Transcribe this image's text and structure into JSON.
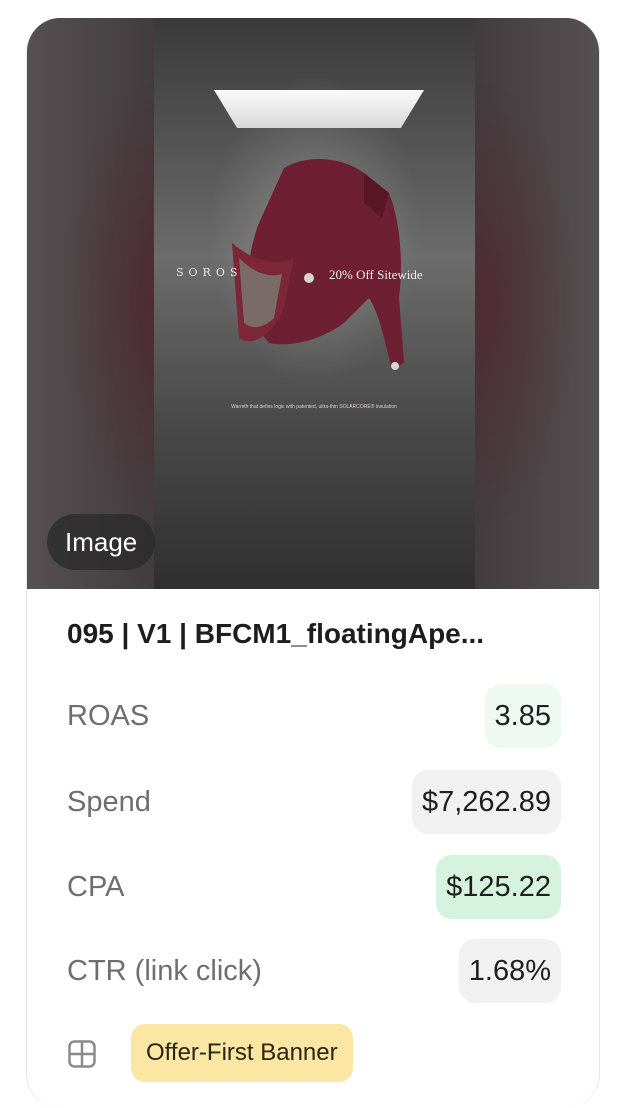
{
  "creative": {
    "media_type_badge": "Image",
    "preview": {
      "brand_wordmark": "SOROS",
      "offer_text": "20% Off Sitewide",
      "tagline": "Warmth that defies logic with patented, ultra-thin SOLARCORE® insulation"
    },
    "title": "095 | V1 | BFCM1_floatingApe...",
    "metrics": [
      {
        "label": "ROAS",
        "value": "3.85"
      },
      {
        "label": "Spend",
        "value": "$7,262.89"
      },
      {
        "label": "CPA",
        "value": "$125.22"
      },
      {
        "label": "CTR (link click)",
        "value": "1.68%"
      }
    ],
    "tag": {
      "icon": "layout-grid-icon",
      "label": "Offer-First Banner"
    },
    "colors": {
      "roas_highlight": "#eefaf1",
      "cpa_highlight": "#d6f3df",
      "neutral_highlight": "#f1f1f1",
      "tag_background": "#fbe7a3",
      "garment": "#6e1f33"
    }
  }
}
